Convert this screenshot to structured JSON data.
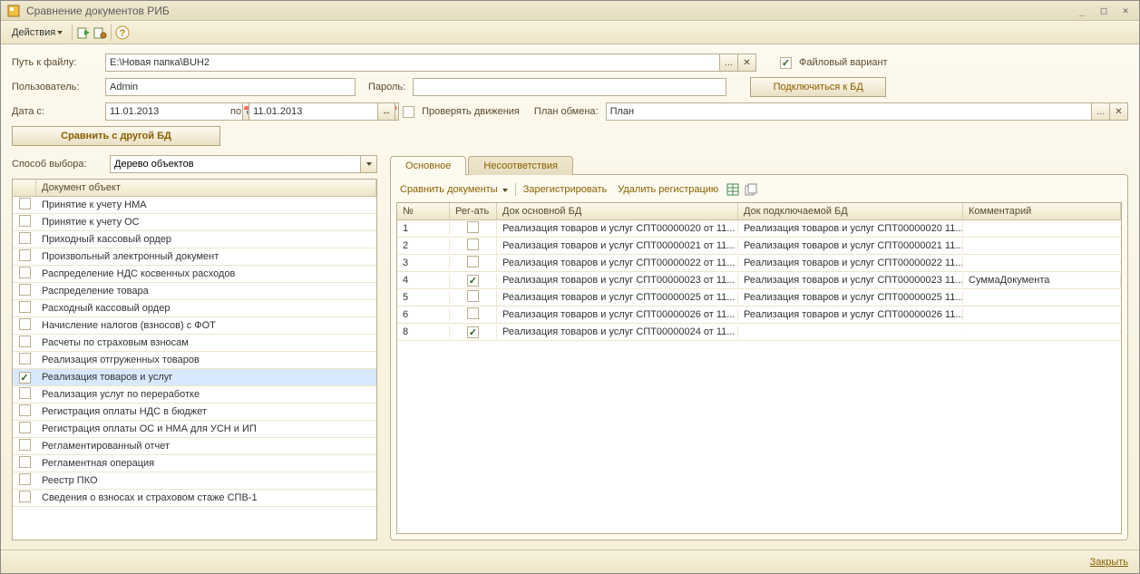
{
  "window": {
    "title": "Сравнение документов РИБ"
  },
  "toolbar": {
    "actions": "Действия"
  },
  "form": {
    "path_label": "Путь к файлу:",
    "path_value": "E:\\Новая папка\\BUH2",
    "user_label": "Пользователь:",
    "user_value": "Admin",
    "password_label": "Пароль:",
    "password_value": "",
    "file_variant": "Файловый вариант",
    "connect_btn": "Подключиться к БД",
    "date_from_label": "Дата с:",
    "date_from": "11.01.2013",
    "date_to_label": "по",
    "date_to": "11.01.2013",
    "check_movements": "Проверять движения",
    "exchange_plan_label": "План обмена:",
    "exchange_plan": "План",
    "compare_btn": "Сравнить с другой БД",
    "select_method_label": "Способ выбора:",
    "select_method": "Дерево объектов"
  },
  "tree": {
    "header": "Документ объект",
    "items": [
      {
        "label": "Принятие к учету НМА",
        "checked": false
      },
      {
        "label": "Принятие к учету ОС",
        "checked": false
      },
      {
        "label": "Приходный кассовый ордер",
        "checked": false
      },
      {
        "label": "Произвольный электронный документ",
        "checked": false
      },
      {
        "label": "Распределение НДС косвенных расходов",
        "checked": false
      },
      {
        "label": "Распределение товара",
        "checked": false
      },
      {
        "label": "Расходный кассовый ордер",
        "checked": false
      },
      {
        "label": "Начисление налогов (взносов) с ФОТ",
        "checked": false
      },
      {
        "label": "Расчеты по страховым взносам",
        "checked": false
      },
      {
        "label": "Реализация отгруженных товаров",
        "checked": false
      },
      {
        "label": "Реализация товаров и услуг",
        "checked": true,
        "selected": true
      },
      {
        "label": "Реализация услуг по переработке",
        "checked": false
      },
      {
        "label": "Регистрация оплаты НДС в бюджет",
        "checked": false
      },
      {
        "label": "Регистрация оплаты ОС и НМА для УСН и ИП",
        "checked": false
      },
      {
        "label": "Регламентированный отчет",
        "checked": false
      },
      {
        "label": "Регламентная операция",
        "checked": false
      },
      {
        "label": "Реестр ПКО",
        "checked": false
      },
      {
        "label": "Сведения о взносах и страховом стаже СПВ-1",
        "checked": false
      }
    ]
  },
  "tabs": {
    "main": "Основное",
    "mismatch": "Несоответствия"
  },
  "panel_tb": {
    "compare": "Сравнить документы",
    "register": "Зарегистрировать",
    "unregister": "Удалить регистрацию"
  },
  "grid": {
    "cols": {
      "num": "№",
      "reg": "Рег-ать",
      "main_db": "Док основной БД",
      "conn_db": "Док подключаемой БД",
      "comment": "Комментарий"
    },
    "rows": [
      {
        "n": "1",
        "reg": false,
        "a": "Реализация товаров и услуг СПТ00000020 от 11...",
        "b": "Реализация товаров и услуг СПТ00000020 11...",
        "c": ""
      },
      {
        "n": "2",
        "reg": false,
        "a": "Реализация товаров и услуг СПТ00000021 от 11...",
        "b": "Реализация товаров и услуг СПТ00000021 11...",
        "c": ""
      },
      {
        "n": "3",
        "reg": false,
        "a": "Реализация товаров и услуг СПТ00000022 от 11...",
        "b": "Реализация товаров и услуг СПТ00000022 11...",
        "c": ""
      },
      {
        "n": "4",
        "reg": true,
        "a": "Реализация товаров и услуг СПТ00000023 от 11...",
        "b": "Реализация товаров и услуг СПТ00000023 11...",
        "c": "СуммаДокумента"
      },
      {
        "n": "5",
        "reg": false,
        "a": "Реализация товаров и услуг СПТ00000025 от 11...",
        "b": "Реализация товаров и услуг СПТ00000025 11...",
        "c": ""
      },
      {
        "n": "6",
        "reg": false,
        "a": "Реализация товаров и услуг СПТ00000026 от 11...",
        "b": "Реализация товаров и услуг СПТ00000026 11...",
        "c": ""
      },
      {
        "n": "8",
        "reg": true,
        "a": "Реализация товаров и услуг СПТ00000024 от 11...",
        "b": "",
        "c": ""
      }
    ]
  },
  "footer": {
    "close": "Закрыть"
  }
}
